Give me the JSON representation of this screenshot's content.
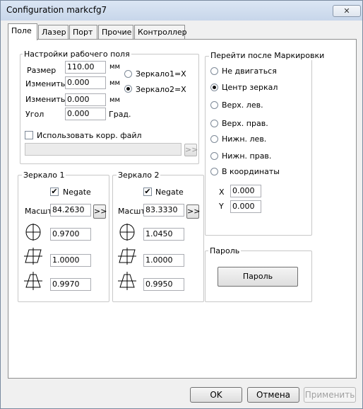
{
  "window": {
    "title": "Configuration markcfg7",
    "close_symbol": "✕"
  },
  "tabs": [
    {
      "label": "Поле",
      "active": true
    },
    {
      "label": "Лазер",
      "active": false
    },
    {
      "label": "Порт",
      "active": false
    },
    {
      "label": "Прочие",
      "active": false
    },
    {
      "label": "Контроллер",
      "active": false
    }
  ],
  "field_settings": {
    "title": "Настройки рабочего поля",
    "size_label": "Размер",
    "size_value": "110.00",
    "size_unit": "мм",
    "change1_label": "Изменить",
    "change1_value": "0.000",
    "change1_unit": "мм",
    "change2_label": "Изменить",
    "change2_value": "0.000",
    "change2_unit": "мм",
    "angle_label": "Угол",
    "angle_value": "0.000",
    "angle_unit": "Град.",
    "mirror1x_label": "Зеркало1=X",
    "mirror1x_checked": false,
    "mirror2x_label": "Зеркало2=X",
    "mirror2x_checked": true,
    "corr_file_label": "Использовать корр. файл",
    "corr_file_checked": false,
    "corr_file_path": "",
    "browse_label": ">>"
  },
  "mirror1": {
    "title": "Зеркало 1",
    "negate_label": "Negate",
    "negate_checked": true,
    "scale_label": "Масшт",
    "scale_value": "84.2630",
    "scale_button": ">>",
    "barrel_value": "0.9700",
    "parallelogram_value": "1.0000",
    "trapezoid_value": "0.9970"
  },
  "mirror2": {
    "title": "Зеркало 2",
    "negate_label": "Negate",
    "negate_checked": true,
    "scale_label": "Масшт",
    "scale_value": "83.3330",
    "scale_button": ">>",
    "barrel_value": "1.0450",
    "parallelogram_value": "1.0000",
    "trapezoid_value": "0.9950"
  },
  "after_marking": {
    "title": "Перейти после Маркировки",
    "options": [
      {
        "label": "Не двигаться",
        "checked": false
      },
      {
        "label": "Центр зеркал",
        "checked": true
      },
      {
        "label": "Верх. лев.",
        "checked": false
      },
      {
        "label": "Верх. прав.",
        "checked": false
      },
      {
        "label": "Нижн. лев.",
        "checked": false
      },
      {
        "label": "Нижн. прав.",
        "checked": false
      },
      {
        "label": "В координаты",
        "checked": false
      }
    ],
    "x_label": "X",
    "x_value": "0.000",
    "y_label": "Y",
    "y_value": "0.000"
  },
  "password": {
    "title": "Пароль",
    "button_label": "Пароль"
  },
  "footer": {
    "ok": "OK",
    "cancel": "Отмена",
    "apply": "Применить"
  }
}
